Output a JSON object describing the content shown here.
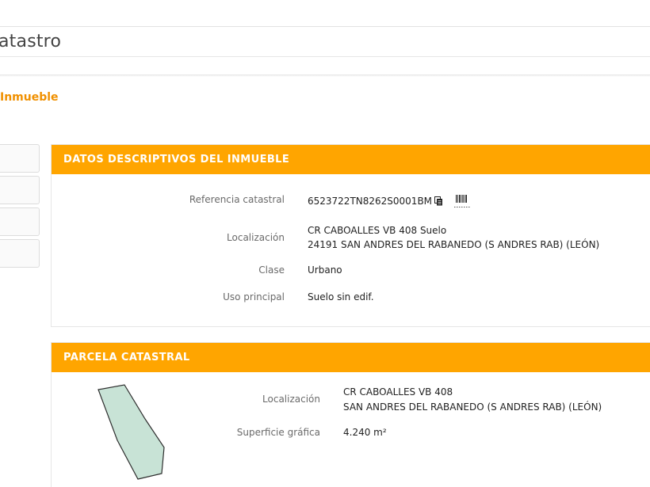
{
  "header": {
    "app_title": "atastro"
  },
  "page": {
    "heading": "Inmueble"
  },
  "datos_descriptivos": {
    "title": "DATOS DESCRIPTIVOS DEL INMUEBLE",
    "referencia_label": "Referencia catastral",
    "referencia_value": "6523722TN8262S0001BM",
    "localizacion_label": "Localización",
    "localizacion_line1": "CR CABOALLES VB 408 Suelo",
    "localizacion_line2": "24191 SAN ANDRES DEL RABANEDO (S ANDRES RAB) (LEÓN)",
    "clase_label": "Clase",
    "clase_value": "Urbano",
    "uso_label": "Uso principal",
    "uso_value": "Suelo sin edif."
  },
  "parcela": {
    "title": "PARCELA CATASTRAL",
    "localizacion_label": "Localización",
    "localizacion_line1": "CR CABOALLES VB 408",
    "localizacion_line2": "SAN ANDRES DEL RABANEDO (S ANDRES RAB) (LEÓN)",
    "superficie_label": "Superficie gráfica",
    "superficie_value": "4.240 m²"
  },
  "icons": {
    "copy": "copy-icon",
    "barcode": "barcode-icon"
  },
  "colors": {
    "accent": "#ffa500",
    "heading": "#f09000",
    "parcel_fill": "#c8e3d6"
  }
}
